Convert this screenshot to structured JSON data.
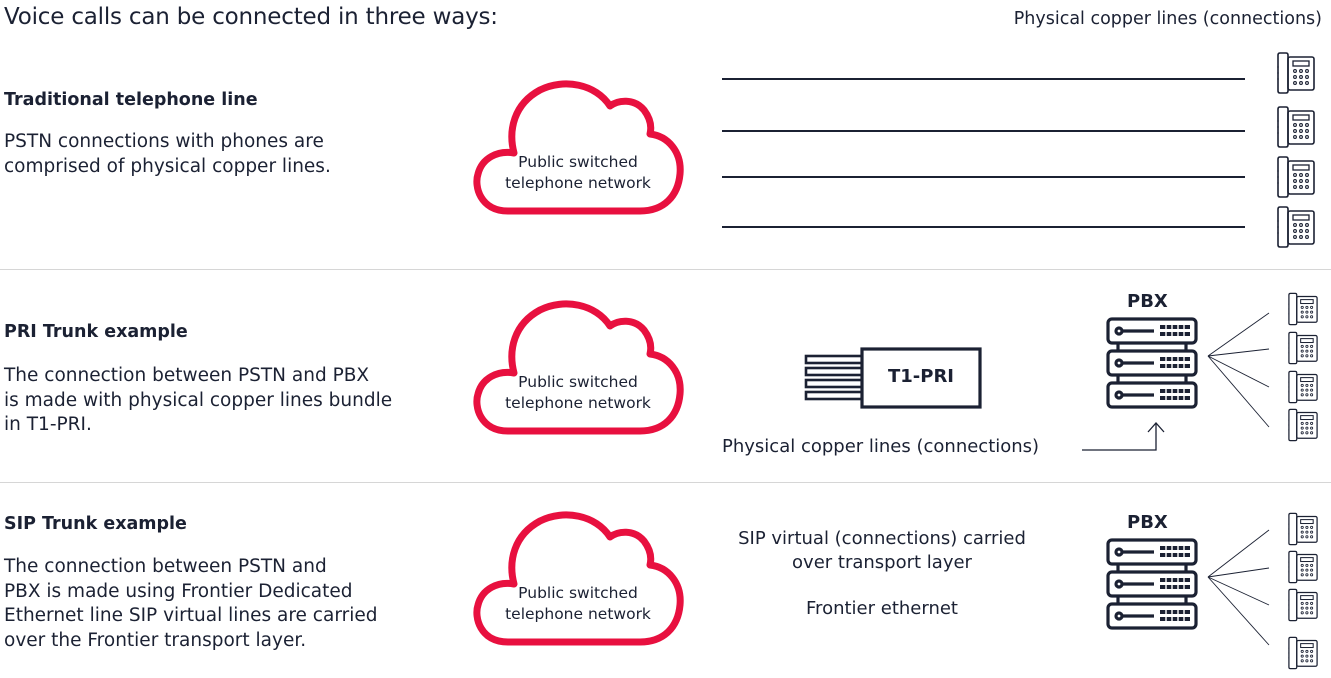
{
  "title": "Voice calls can be connected in three ways:",
  "colors": {
    "cloud_stroke": "#e8103f",
    "text": "#1b2133",
    "divider": "#d6d6d6"
  },
  "sections": [
    {
      "heading": "Traditional telephone line",
      "body": "PSTN connections with phones are\ncomprised of physical copper lines.",
      "cloud_label": "Public switched\ntelephone network",
      "connection_label": "Physical copper lines (connections)",
      "phone_count": 4
    },
    {
      "heading": "PRI Trunk example",
      "body": "The connection between PSTN and PBX\nis made with physical copper lines bundle\nin T1-PRI.",
      "cloud_label": "Public switched\ntelephone network",
      "trunk_label": "T1-PRI",
      "connection_label": "Physical copper lines (connections)",
      "pbx_label": "PBX",
      "phone_count": 4
    },
    {
      "heading": "SIP Trunk example",
      "body": "The connection between PSTN and\nPBX is made using Frontier Dedicated\nEthernet line SIP virtual lines are carried\nover the Frontier transport layer.",
      "cloud_label": "Public switched\ntelephone network",
      "transport_label": "SIP virtual (connections) carried\nover transport layer",
      "ethernet_label": "Frontier ethernet",
      "pbx_label": "PBX",
      "phone_count": 4
    }
  ],
  "icons": {
    "cloud": "cloud-icon",
    "phone": "desk-phone-icon",
    "server": "pbx-server-icon",
    "trunk": "t1-pri-bundle-icon",
    "arrow": "arrow-up-icon"
  }
}
